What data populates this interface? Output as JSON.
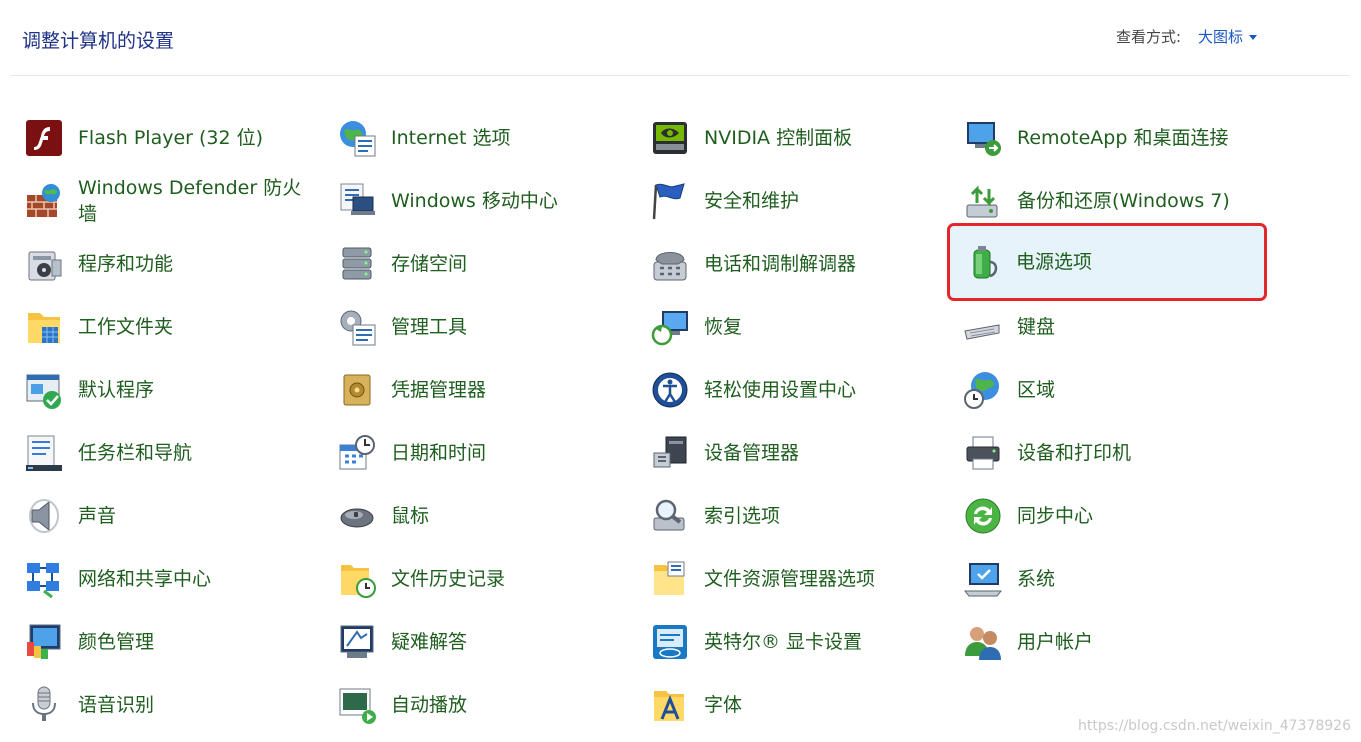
{
  "header": {
    "title": "调整计算机的设置",
    "view_by_label": "查看方式:",
    "view_by_value": "大图标"
  },
  "columns": [
    [
      {
        "label": "Flash Player (32 位)",
        "icon": "flash-icon"
      },
      {
        "label": "Windows Defender 防火墙",
        "icon": "firewall-icon"
      },
      {
        "label": "程序和功能",
        "icon": "programs-icon"
      },
      {
        "label": "工作文件夹",
        "icon": "work-folders-icon"
      },
      {
        "label": "默认程序",
        "icon": "default-programs-icon"
      },
      {
        "label": "任务栏和导航",
        "icon": "taskbar-icon"
      },
      {
        "label": "声音",
        "icon": "sound-icon"
      },
      {
        "label": "网络和共享中心",
        "icon": "network-icon"
      },
      {
        "label": "颜色管理",
        "icon": "color-management-icon"
      },
      {
        "label": "语音识别",
        "icon": "microphone-icon"
      }
    ],
    [
      {
        "label": "Internet 选项",
        "icon": "internet-options-icon"
      },
      {
        "label": "Windows 移动中心",
        "icon": "mobility-center-icon"
      },
      {
        "label": "存储空间",
        "icon": "storage-icon"
      },
      {
        "label": "管理工具",
        "icon": "admin-tools-icon"
      },
      {
        "label": "凭据管理器",
        "icon": "credential-icon"
      },
      {
        "label": "日期和时间",
        "icon": "date-time-icon"
      },
      {
        "label": "鼠标",
        "icon": "mouse-icon"
      },
      {
        "label": "文件历史记录",
        "icon": "file-history-icon"
      },
      {
        "label": "疑难解答",
        "icon": "troubleshoot-icon"
      },
      {
        "label": "自动播放",
        "icon": "autoplay-icon"
      }
    ],
    [
      {
        "label": "NVIDIA 控制面板",
        "icon": "nvidia-icon"
      },
      {
        "label": "安全和维护",
        "icon": "security-flag-icon"
      },
      {
        "label": "电话和调制解调器",
        "icon": "phone-icon"
      },
      {
        "label": "恢复",
        "icon": "recovery-icon"
      },
      {
        "label": "轻松使用设置中心",
        "icon": "ease-of-access-icon"
      },
      {
        "label": "设备管理器",
        "icon": "device-manager-icon"
      },
      {
        "label": "索引选项",
        "icon": "indexing-icon"
      },
      {
        "label": "文件资源管理器选项",
        "icon": "explorer-options-icon"
      },
      {
        "label": "英特尔® 显卡设置",
        "icon": "intel-graphics-icon"
      },
      {
        "label": "字体",
        "icon": "fonts-icon"
      }
    ],
    [
      {
        "label": "RemoteApp 和桌面连接",
        "icon": "remoteapp-icon"
      },
      {
        "label": "备份和还原(Windows 7)",
        "icon": "backup-icon"
      },
      {
        "label": "电源选项",
        "icon": "power-icon",
        "highlighted": true
      },
      {
        "label": "键盘",
        "icon": "keyboard-icon"
      },
      {
        "label": "区域",
        "icon": "region-icon"
      },
      {
        "label": "设备和打印机",
        "icon": "printer-icon"
      },
      {
        "label": "同步中心",
        "icon": "sync-icon"
      },
      {
        "label": "系统",
        "icon": "system-icon"
      },
      {
        "label": "用户帐户",
        "icon": "user-accounts-icon"
      }
    ]
  ],
  "watermark": "https://blog.csdn.net/weixin_47378926",
  "colors": {
    "title": "#1e3287",
    "item_label": "#1f5e1f",
    "link": "#1a56c4",
    "highlight_bg": "#e6f3fb",
    "highlight_border": "#e2262b"
  }
}
